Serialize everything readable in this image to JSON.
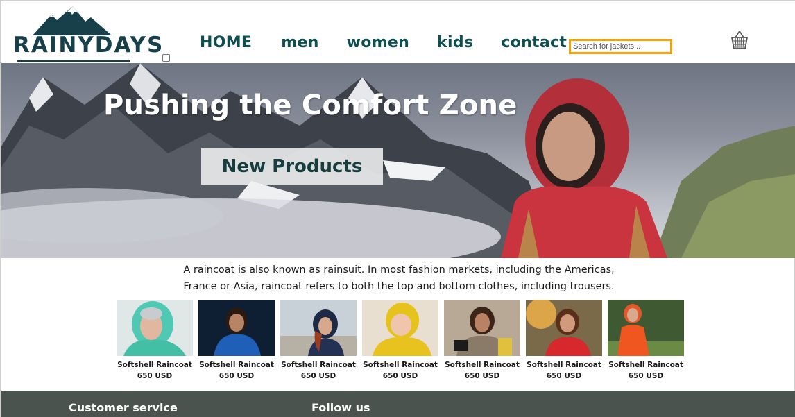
{
  "brand": {
    "name": "RAINYDAYS"
  },
  "nav": {
    "items": [
      {
        "label": "HOME"
      },
      {
        "label": "men"
      },
      {
        "label": "women"
      },
      {
        "label": "kids"
      },
      {
        "label": "contact"
      }
    ]
  },
  "search": {
    "placeholder": "Search for jackets..."
  },
  "icons": {
    "cart": "basket-icon"
  },
  "colors": {
    "nav": "#0f4f52",
    "search_border": "#f0a30a",
    "footer": "#4a534e"
  },
  "hero": {
    "title": "Pushing the Comfort Zone",
    "button_label": "New Products"
  },
  "description": "A raincoat is also known as rainsuit. In most fashion markets, including the Americas, France or Asia, raincoat refers to both the top and bottom clothes, including trousers.",
  "products": [
    {
      "name": "Softshell Raincoat",
      "price": "650 USD"
    },
    {
      "name": "Softshell Raincoat",
      "price": "650 USD"
    },
    {
      "name": "Softshell Raincoat",
      "price": "650 USD"
    },
    {
      "name": "Softshell Raincoat",
      "price": "650 USD"
    },
    {
      "name": "Softshell Raincoat",
      "price": "650 USD"
    },
    {
      "name": "Softshell Raincoat",
      "price": "650 USD"
    },
    {
      "name": "Softshell Raincoat",
      "price": "650 USD"
    }
  ],
  "footer": {
    "customer_service": "Customer service",
    "follow_us": "Follow us"
  }
}
